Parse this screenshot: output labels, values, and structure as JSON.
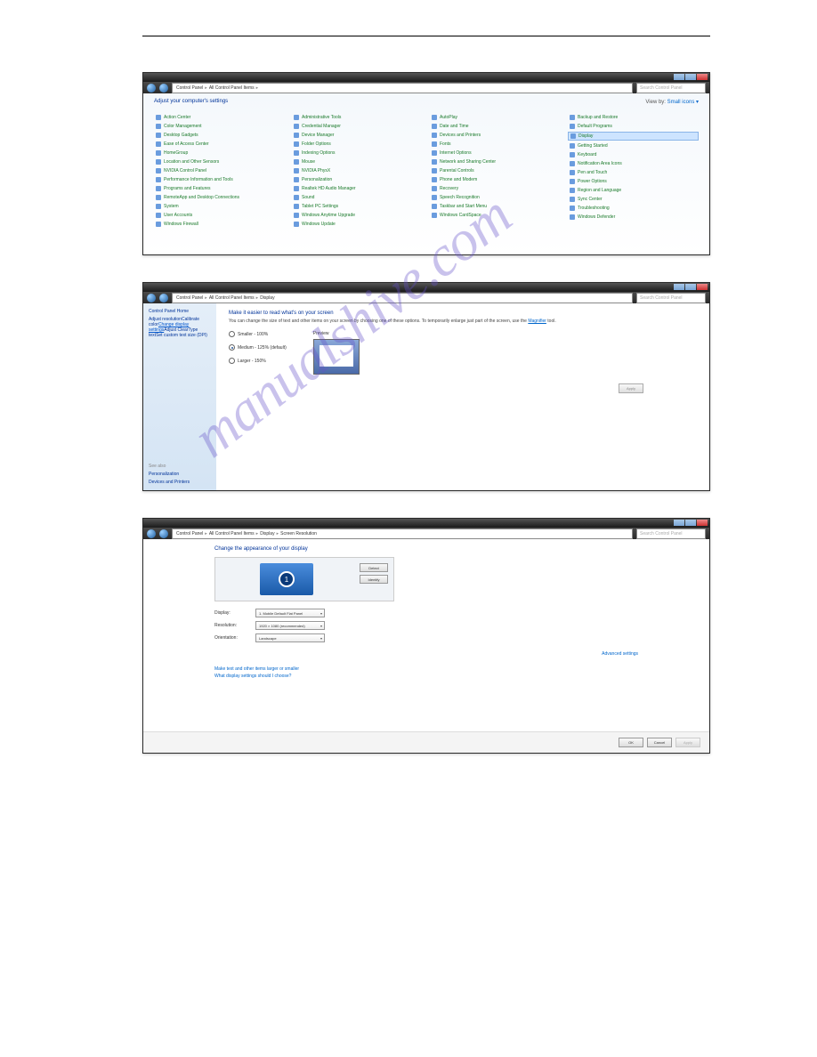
{
  "watermark": "manualshive.com",
  "win1": {
    "breadcrumbs": [
      "Control Panel",
      "All Control Panel Items"
    ],
    "search": "Search Control Panel",
    "title": "Adjust your computer's settings",
    "viewby_label": "View by:",
    "viewby_value": "Small icons ▾",
    "highlight": "Display",
    "cols": [
      [
        "Action Center",
        "Color Management",
        "Desktop Gadgets",
        "Ease of Access Center",
        "HomeGroup",
        "Location and Other Sensors",
        "NVIDIA Control Panel",
        "Performance Information and Tools",
        "Programs and Features",
        "RemoteApp and Desktop Connections",
        "System",
        "User Accounts",
        "Windows Firewall"
      ],
      [
        "Administrative Tools",
        "Credential Manager",
        "Device Manager",
        "Folder Options",
        "Indexing Options",
        "Mouse",
        "NVIDIA PhysX",
        "Personalization",
        "Realtek HD Audio Manager",
        "Sound",
        "Tablet PC Settings",
        "Windows Anytime Upgrade",
        "Windows Update"
      ],
      [
        "AutoPlay",
        "Date and Time",
        "Devices and Printers",
        "Fonts",
        "Internet Options",
        "Network and Sharing Center",
        "Parental Controls",
        "Phone and Modem",
        "Recovery",
        "Speech Recognition",
        "Taskbar and Start Menu",
        "Windows CardSpace"
      ],
      [
        "Backup and Restore",
        "Default Programs",
        "Display",
        "Getting Started",
        "Keyboard",
        "Notification Area Icons",
        "Pen and Touch",
        "Power Options",
        "Region and Language",
        "Sync Center",
        "Troubleshooting",
        "Windows Defender"
      ]
    ]
  },
  "win2": {
    "breadcrumbs": [
      "Control Panel",
      "All Control Panel Items",
      "Display"
    ],
    "search": "Search Control Panel",
    "sidebar_title": "Control Panel Home",
    "sidebar_items": [
      "Adjust resolution",
      "Calibrate color",
      "Change display settings",
      "Adjust ClearType text",
      "Set custom text size (DPI)"
    ],
    "sidebar_active": "Change display settings",
    "see_also": "See also",
    "see_items": [
      "Personalization",
      "Devices and Printers"
    ],
    "heading": "Make it easier to read what's on your screen",
    "desc_pre": "You can change the size of text and other items on your screen by choosing one of these options. To temporarily enlarge just part of the screen, use the ",
    "desc_link": "Magnifier",
    "desc_post": " tool.",
    "radios": [
      "Smaller - 100%",
      "Medium - 125% (default)",
      "Larger - 150%"
    ],
    "radio_selected": 1,
    "preview_label": "Preview",
    "apply": "Apply"
  },
  "win3": {
    "breadcrumbs": [
      "Control Panel",
      "All Control Panel Items",
      "Display",
      "Screen Resolution"
    ],
    "search": "Search Control Panel",
    "heading": "Change the appearance of your display",
    "monitor_num": "1",
    "detect": "Detect",
    "identify": "Identify",
    "rows": [
      {
        "label": "Display:",
        "value": "1. Mobile Default Flat Panel"
      },
      {
        "label": "Resolution:",
        "value": "1920 × 1080 (recommended)"
      },
      {
        "label": "Orientation:",
        "value": "Landscape"
      }
    ],
    "adv_link": "Advanced settings",
    "link1": "Make text and other items larger or smaller",
    "link2": "What display settings should I choose?",
    "ok": "OK",
    "cancel": "Cancel",
    "apply": "Apply"
  }
}
